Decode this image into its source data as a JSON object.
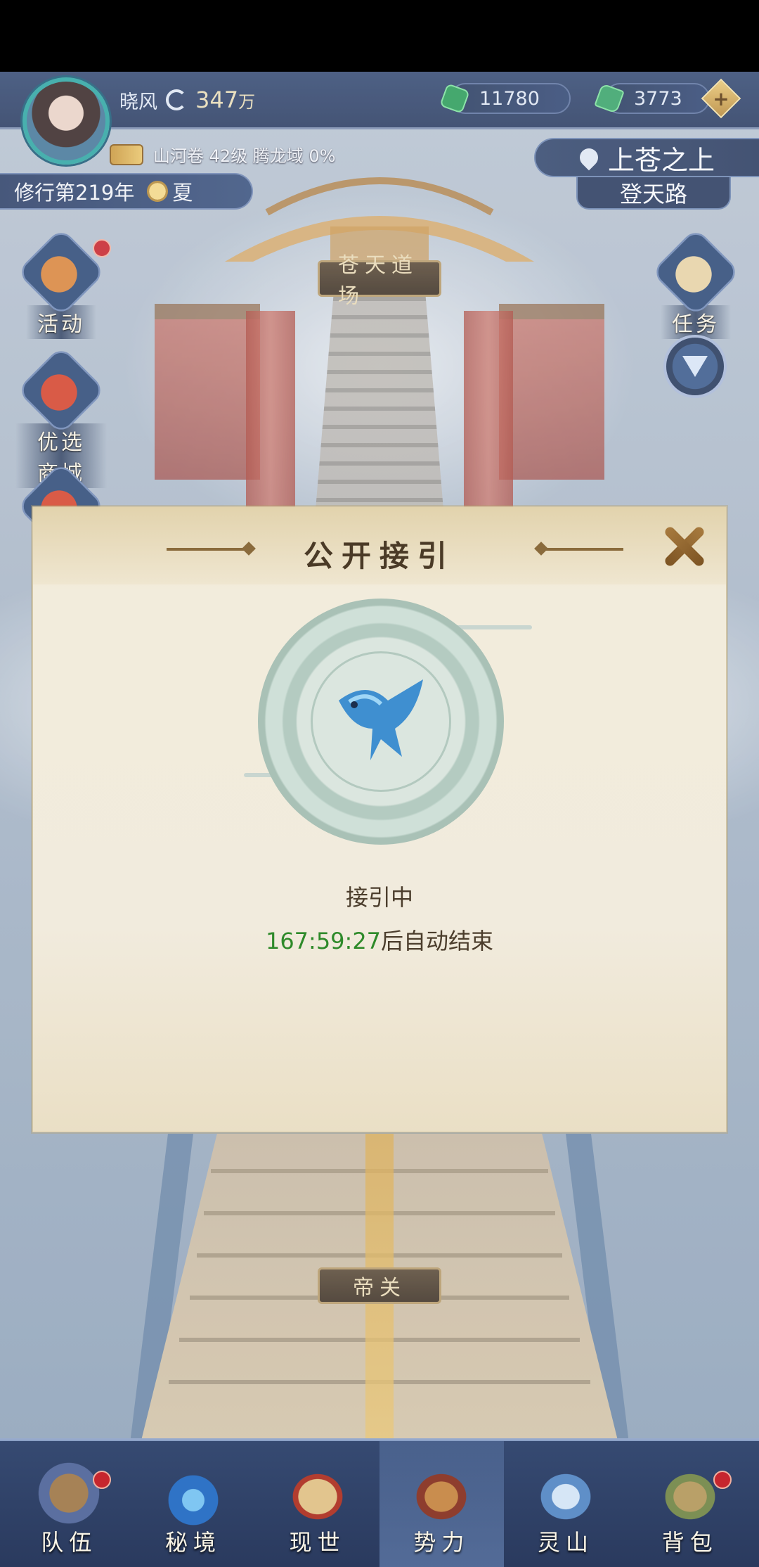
{
  "player": {
    "name": "晓风",
    "power_value": "347",
    "power_unit": "万",
    "info_line": "山河卷 42级 腾龙域 0%",
    "year_label": "修行第219年",
    "season": "夏"
  },
  "currencies": [
    {
      "value": "11780"
    },
    {
      "value": "3773"
    }
  ],
  "plus_label": "+",
  "location": {
    "title": "上苍之上",
    "subtitle": "登天路"
  },
  "scene": {
    "top_plaque": "苍天道场",
    "bottom_plaque": "帝关"
  },
  "side_left": [
    {
      "label": "活动",
      "has_dot": true
    },
    {
      "label": "优选商城",
      "has_dot": false
    }
  ],
  "side_right": [
    {
      "label": "任务",
      "has_dot": false
    }
  ],
  "dialog": {
    "title": "公开接引",
    "status": "接引中",
    "timer": "167:59:27",
    "timer_suffix": "后自动结束"
  },
  "nav": [
    {
      "label": "队伍",
      "has_dot": true,
      "active": false
    },
    {
      "label": "秘境",
      "has_dot": false,
      "active": false
    },
    {
      "label": "现世",
      "has_dot": false,
      "active": false
    },
    {
      "label": "势力",
      "has_dot": false,
      "active": true
    },
    {
      "label": "灵山",
      "has_dot": false,
      "active": false
    },
    {
      "label": "背包",
      "has_dot": true,
      "active": false
    }
  ],
  "colors": {
    "accent_gold": "#c9983f",
    "hud_blue": "#2b3d63",
    "timer_green": "#2e8a2a",
    "alert_red": "#c6262e"
  }
}
